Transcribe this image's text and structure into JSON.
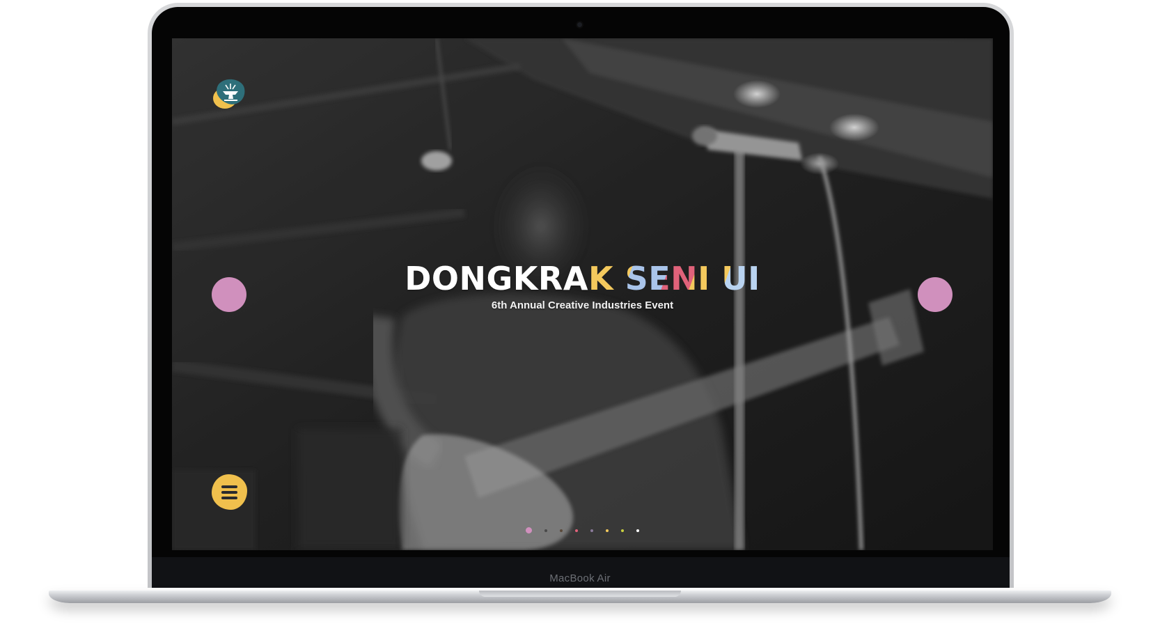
{
  "device": {
    "model_label": "MacBook Air"
  },
  "site": {
    "logo_icon": "anvil-emblem-icon",
    "menu_icon": "hamburger-menu-icon",
    "prev_arrow_icon": "previous-slide-icon",
    "next_arrow_icon": "next-slide-icon"
  },
  "hero": {
    "title_main": "DONGKRA",
    "title_accent": "K SENI UI",
    "subtitle": "6th Annual Creative Industries Event"
  },
  "slider": {
    "active_index": 0,
    "dots": [
      {
        "color": "#d090bd"
      },
      {
        "color": "#4a4a4a"
      },
      {
        "color": "#5a4a3a"
      },
      {
        "color": "#e0627a"
      },
      {
        "color": "#8a7a9a"
      },
      {
        "color": "#f4c95d"
      },
      {
        "color": "#c8d040"
      },
      {
        "color": "#ffffff"
      }
    ]
  },
  "colors": {
    "accent_pink": "#d090bd",
    "accent_yellow": "#f0c04d",
    "logo_teal": "#2e6f7a",
    "screen_bg": "#2c2c2c"
  }
}
